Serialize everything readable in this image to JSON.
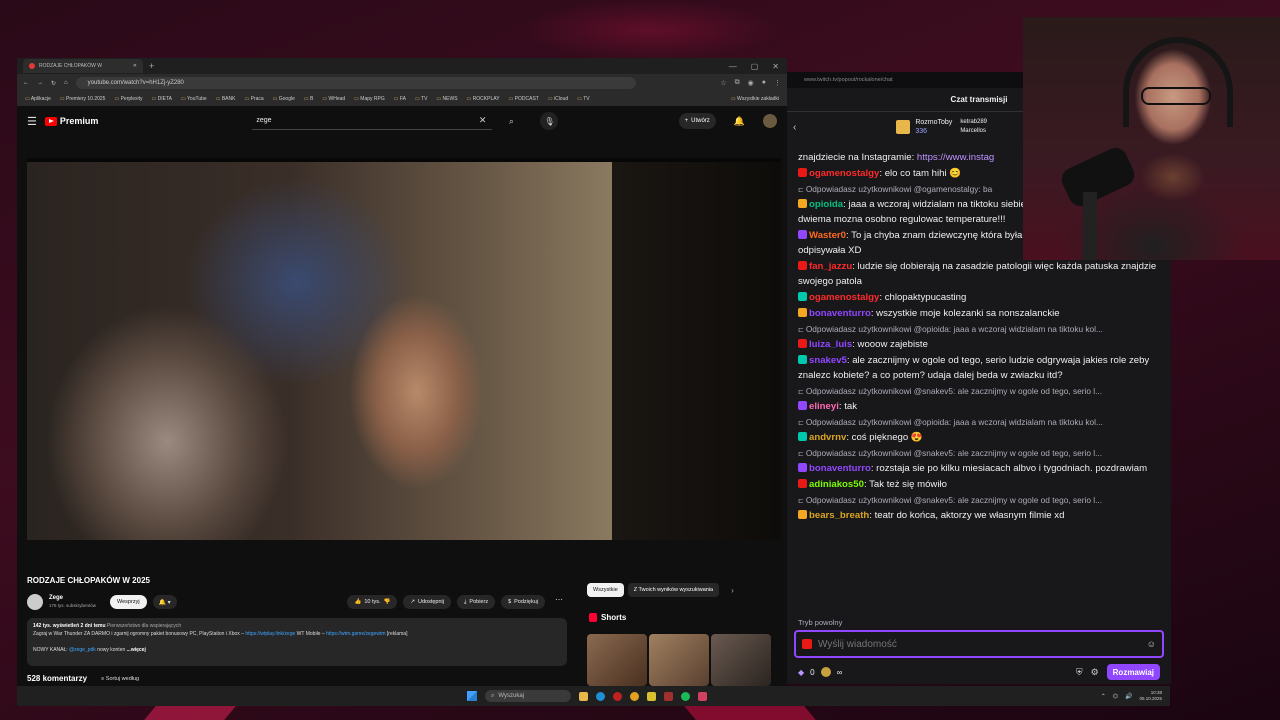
{
  "browser": {
    "tab_title": "RODZAJE CHŁOPAKÓW W",
    "url": "youtube.com/watch?v=hH1Zj-yZ280",
    "bookmarks": [
      "Aplikacje",
      "Premiery 10.2025",
      "Perplexity",
      "DIETA",
      "YouTube",
      "BANK",
      "Praca",
      "Google",
      "B",
      "WHead",
      "Mapy RPG",
      "FA",
      "TV",
      "NEWS",
      "ROCKPLAY",
      "PODCAST",
      "iCloud",
      "TV"
    ],
    "bookmarks_other": "Wszystkie zakładki"
  },
  "youtube": {
    "logo": "Premium",
    "search_value": "zege",
    "create_label": "Utwórz",
    "video_title": "RODZAJE CHŁOPAKÓW W 2025",
    "channel_name": "Zege",
    "channel_subs": "176 tys. subskrybentów",
    "support_label": "Wesprzyj",
    "likes": "10 tys.",
    "share_label": "Udostępnij",
    "download_label": "Pobierz",
    "thanks_label": "Podziękuj",
    "desc_stats": "142 tys. wyświetleń  2 dni temu",
    "desc_tag": "Pierwszeństwo dla wspierających",
    "desc_line1": "Zagraj w War Thunder ZA DARMO i zgarnij ogromny pakiet bonusowy PC, PlayStation i Xbox –",
    "desc_link1": "https://wtplay.link/zege",
    "desc_mid": "WT Mobile –",
    "desc_link2": "https://wtm.game/zegewtm",
    "desc_ad": "[reklama]",
    "desc_line2_pre": "NOWY KANAŁ:",
    "desc_link3": "@zege_pdk",
    "desc_line2_post": "nowy konten",
    "desc_more": "...więcej",
    "comments_count": "528 komentarzy",
    "sort_label": "Sortuj według",
    "chip_all": "Wszystkie",
    "chip_search": "Z Twoich wyników wyszukiwania",
    "shorts_label": "Shorts"
  },
  "chat": {
    "url": "www.twitch.tv/popout/rockalone/chat",
    "header": "Czat transmisji",
    "top_gifter": "RozmoToby",
    "top_gifter_count": "336",
    "gifter2": "ketrab289",
    "gifter3": "Marcellos",
    "messages": [
      {
        "type": "text",
        "user": "",
        "text": "znajdziecie na Instagramie: ",
        "link": "https://www.instag"
      },
      {
        "type": "msg",
        "user": "ogamenostalgy",
        "color": "u-red",
        "text": ": elo co tam hihi 😊"
      },
      {
        "type": "reply",
        "text": "Odpowiadasz użytkownikowi @ogamenostalgy: ba"
      },
      {
        "type": "msg",
        "user": "opioida",
        "color": "u-green",
        "text": ": jaaa a wczoraj widzialam na tiktoku siebie i zony dwuosobowy prysznic, z dwiema mozna osobno regulowac temperature!!!"
      },
      {
        "type": "msg",
        "user": "Waster0",
        "color": "u-orange",
        "text": ": To ja chyba znam dziewczynę która była nonszalancka bo też mi nie odpisywała XD"
      },
      {
        "type": "msg",
        "user": "fan_jazzu",
        "color": "u-red",
        "text": ": ludzie się dobierają na zasadzie patologii więc każda patuska znajdzie swojego patola"
      },
      {
        "type": "msg",
        "user": "ogamenostalgy",
        "color": "u-red",
        "text": ": chlopaktypucasting"
      },
      {
        "type": "msg",
        "user": "bonaventurro",
        "color": "u-purple",
        "text": ": wszystkie moje kolezanki sa nonszalanckie"
      },
      {
        "type": "reply",
        "text": "Odpowiadasz użytkownikowi @opioida: jaaa a wczoraj widzialam na tiktoku kol..."
      },
      {
        "type": "msg",
        "user": "luiza_luis",
        "color": "u-purple",
        "text": ": wooow zajebiste"
      },
      {
        "type": "msg",
        "user": "snakev5",
        "color": "u-purple",
        "text": ": ale zacznijmy w ogole od tego, serio ludzie odgrywaja jakies role zeby znalezc kobiete? a co potem? udaja dalej beda w zwiazku itd?"
      },
      {
        "type": "reply",
        "text": "Odpowiadasz użytkownikowi @snakev5: ale zacznijmy w ogole od tego, serio l..."
      },
      {
        "type": "msg",
        "user": "elineyi",
        "color": "u-pink",
        "text": ": tak"
      },
      {
        "type": "reply",
        "text": "Odpowiadasz użytkownikowi @opioida: jaaa a wczoraj widzialam na tiktoku kol..."
      },
      {
        "type": "msg",
        "user": "andvrnv",
        "color": "u-gold",
        "text": ": coś pięknego 😍"
      },
      {
        "type": "reply",
        "text": "Odpowiadasz użytkownikowi @snakev5: ale zacznijmy w ogole od tego, serio l..."
      },
      {
        "type": "msg",
        "user": "bonaventurro",
        "color": "u-purple",
        "text": ": rozstaja sie po kilku miesiacach albvo i tygodniach. pozdrawiam"
      },
      {
        "type": "msg",
        "user": "adiniakos50",
        "color": "u-lime",
        "text": ": Tak też się mówiło"
      },
      {
        "type": "reply",
        "text": "Odpowiadasz użytkownikowi @snakev5: ale zacznijmy w ogole od tego, serio l..."
      },
      {
        "type": "msg",
        "user": "bears_breath",
        "color": "u-gold",
        "text": ": teatr do końca, aktorzy we własnym filmie xd"
      }
    ],
    "slow_mode": "Tryb powolny",
    "input_placeholder": "Wyślij wiadomość",
    "bits": "0",
    "send_label": "Rozmawiaj"
  },
  "taskbar": {
    "search_placeholder": "Wyszukaj",
    "time": "10:38",
    "date": "05.10.2025"
  }
}
